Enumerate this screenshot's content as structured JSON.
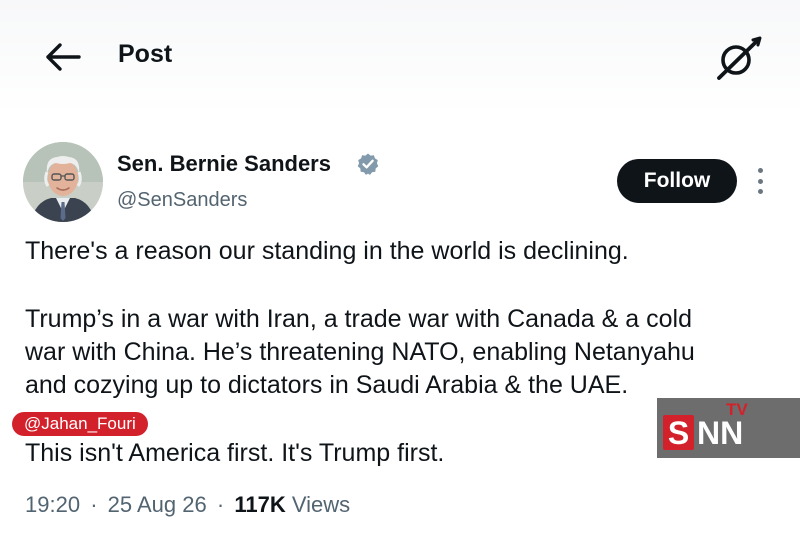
{
  "header": {
    "title": "Post"
  },
  "author": {
    "name": "Sen. Bernie Sanders",
    "handle": "@SenSanders"
  },
  "actions": {
    "follow_label": "Follow"
  },
  "tweet": {
    "lines": [
      "There's a reason our standing in the world is declining.",
      "Trump’s in a war with Iran, a trade war with Canada & a cold",
      "war with China. He’s threatening NATO, enabling Netanyahu",
      "and cozying up to dictators in Saudi Arabia & the UAE.",
      "This isn't America first. It's Trump first."
    ]
  },
  "meta": {
    "time": "19:20",
    "date": "25 Aug 26",
    "views_count": "117K",
    "views_label": "Views",
    "separator": "·"
  },
  "watermark": {
    "label": "@Jahan_Fouri"
  },
  "logo": {
    "letters": "SNN",
    "tv": "TV"
  },
  "colors": {
    "text": "#0f1419",
    "secondary": "#536471",
    "button": "#0f1419",
    "verified": "#829aab",
    "watermark": "#d3212c",
    "logo_red": "#d3212c",
    "logo_bg": "#6d6d6d"
  },
  "icons": {
    "back": "arrow-left-icon",
    "grok": "grok-icon",
    "verified": "verified-badge-icon",
    "more": "more-vertical-icon"
  }
}
